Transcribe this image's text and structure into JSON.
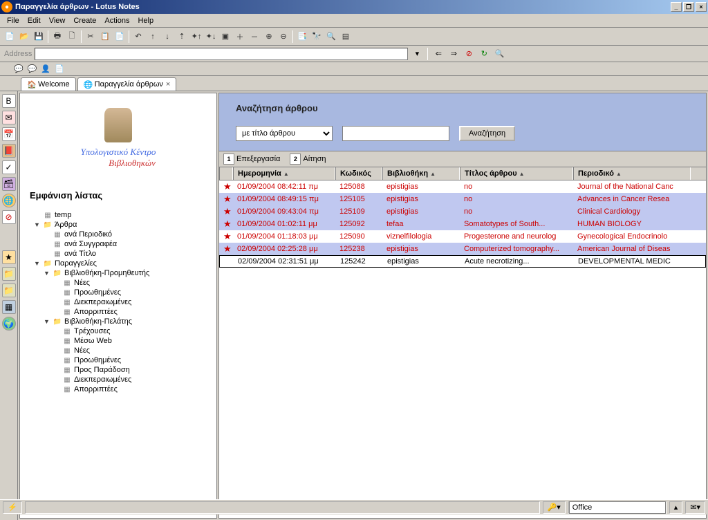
{
  "window": {
    "title": "Παραγγελία άρθρων - Lotus Notes"
  },
  "menu": {
    "file": "File",
    "edit": "Edit",
    "view": "View",
    "create": "Create",
    "actions": "Actions",
    "help": "Help"
  },
  "address": {
    "label": "Address"
  },
  "tabs": {
    "welcome": "Welcome",
    "orders": "Παραγγελία άρθρων"
  },
  "logo": {
    "line1": "Υπολογιστικό Κέντρο",
    "line2": "Βιβλιοθηκών"
  },
  "tree": {
    "title": "Εμφάνιση λίστας",
    "temp": "temp",
    "articles": "Άρθρα",
    "byJournal": "ανά Περιοδικό",
    "byAuthor": "ανά Συγγραφέα",
    "byTitle": "ανά Τίτλο",
    "orders": "Παραγγελίες",
    "libSupplier": "Βιβλιοθήκη-Προμηθευτής",
    "new": "Νέες",
    "forwarded": "Προωθημένες",
    "processed": "Διεκπεραιωμένες",
    "rejected": "Απορριπτέες",
    "libClient": "Βιβλιοθήκη-Πελάτης",
    "current": "Τρέχουσες",
    "viaWeb": "Μέσω Web",
    "forDelivery": "Προς Παράδοση"
  },
  "search": {
    "title": "Αναζήτηση άρθρου",
    "selectLabel": "με τίτλο άρθρου",
    "button": "Αναζήτηση"
  },
  "actions": {
    "edit": "Επεξεργασία",
    "request": "Αίτηση"
  },
  "columns": {
    "date": "Ημερομηνία",
    "code": "Κωδικός",
    "library": "Βιβλιοθήκη",
    "title": "Τίτλος άρθρου",
    "journal": "Περιοδικό"
  },
  "rows": [
    {
      "star": true,
      "date": "01/09/2004 08:42:11 πμ",
      "code": "125088",
      "lib": "epistigias",
      "title": "no",
      "journal": "Journal of the National Canc",
      "red": true,
      "hl": false
    },
    {
      "star": true,
      "date": "01/09/2004 08:49:15 πμ",
      "code": "125105",
      "lib": "epistigias",
      "title": "no",
      "journal": "Advances in Cancer Resea",
      "red": true,
      "hl": true
    },
    {
      "star": true,
      "date": "01/09/2004 09:43:04 πμ",
      "code": "125109",
      "lib": "epistigias",
      "title": "no",
      "journal": "Clinical Cardiology",
      "red": true,
      "hl": true
    },
    {
      "star": true,
      "date": "01/09/2004 01:02:11 μμ",
      "code": "125092",
      "lib": "tefaa",
      "title": "Somatotypes of South...",
      "journal": "HUMAN BIOLOGY",
      "red": true,
      "hl": true
    },
    {
      "star": true,
      "date": "01/09/2004 01:18:03 μμ",
      "code": "125090",
      "lib": "viznelfilologia",
      "title": "Progesterone and neurolog",
      "journal": "Gynecological Endocrinolo",
      "red": true,
      "hl": false
    },
    {
      "star": true,
      "date": "02/09/2004 02:25:28 μμ",
      "code": "125238",
      "lib": "epistigias",
      "title": "Computerized tomography...",
      "journal": "American Journal of Diseas",
      "red": true,
      "hl": true
    },
    {
      "star": false,
      "date": "02/09/2004 02:31:51 μμ",
      "code": "125242",
      "lib": "epistigias",
      "title": "Acute necrotizing...",
      "journal": "DEVELOPMENTAL MEDIC",
      "red": false,
      "hl": false,
      "boxed": true
    }
  ],
  "status": {
    "office": "Office"
  }
}
